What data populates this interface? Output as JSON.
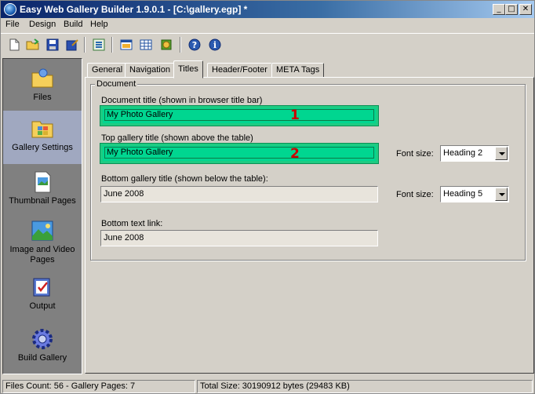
{
  "window": {
    "title": "Easy Web Gallery Builder 1.9.0.1 - [C:\\gallery.egp] *"
  },
  "menu": [
    "File",
    "Design",
    "Build",
    "Help"
  ],
  "toolbar": [
    "new-file",
    "open-folder",
    "save",
    "save-as",
    "properties",
    "preview-browser",
    "thumbnail-grid",
    "build",
    "help",
    "info"
  ],
  "sidebar": {
    "items": [
      {
        "label": "Files",
        "icon": "folder-icon"
      },
      {
        "label": "Gallery Settings",
        "icon": "gallery-settings-icon"
      },
      {
        "label": "Thumbnail Pages",
        "icon": "thumbnail-page-icon"
      },
      {
        "label": "Image and Video Pages",
        "icon": "image-page-icon"
      },
      {
        "label": "Output",
        "icon": "output-icon"
      },
      {
        "label": "Build Gallery",
        "icon": "gear-icon"
      }
    ],
    "active": "Gallery Settings"
  },
  "tabs": [
    "General",
    "Navigation",
    "Titles",
    "Header/Footer",
    "META Tags"
  ],
  "active_tab": "Titles",
  "form": {
    "group_label": "Document",
    "document_title_label": "Document title (shown in browser title bar)",
    "document_title_value": "My Photo Gallery",
    "top_title_label": "Top gallery title (shown above the table)",
    "top_title_value": "My Photo Gallery",
    "bottom_title_label": "Bottom gallery title (shown below the table):",
    "bottom_title_value": "June 2008",
    "bottom_link_label": "Bottom text link:",
    "bottom_link_value": "June 2008",
    "font_size_label": "Font size:",
    "top_font_size": "Heading 2",
    "bottom_font_size": "Heading 5"
  },
  "markers": [
    "1",
    "2"
  ],
  "colors": {
    "highlight": "#00d690",
    "marker": "#cc0000",
    "title_bar": "#0a246a"
  },
  "status": {
    "files": "Files Count: 56 - Gallery Pages: 7",
    "size": "Total Size: 30190912 bytes (29483 KB)"
  }
}
